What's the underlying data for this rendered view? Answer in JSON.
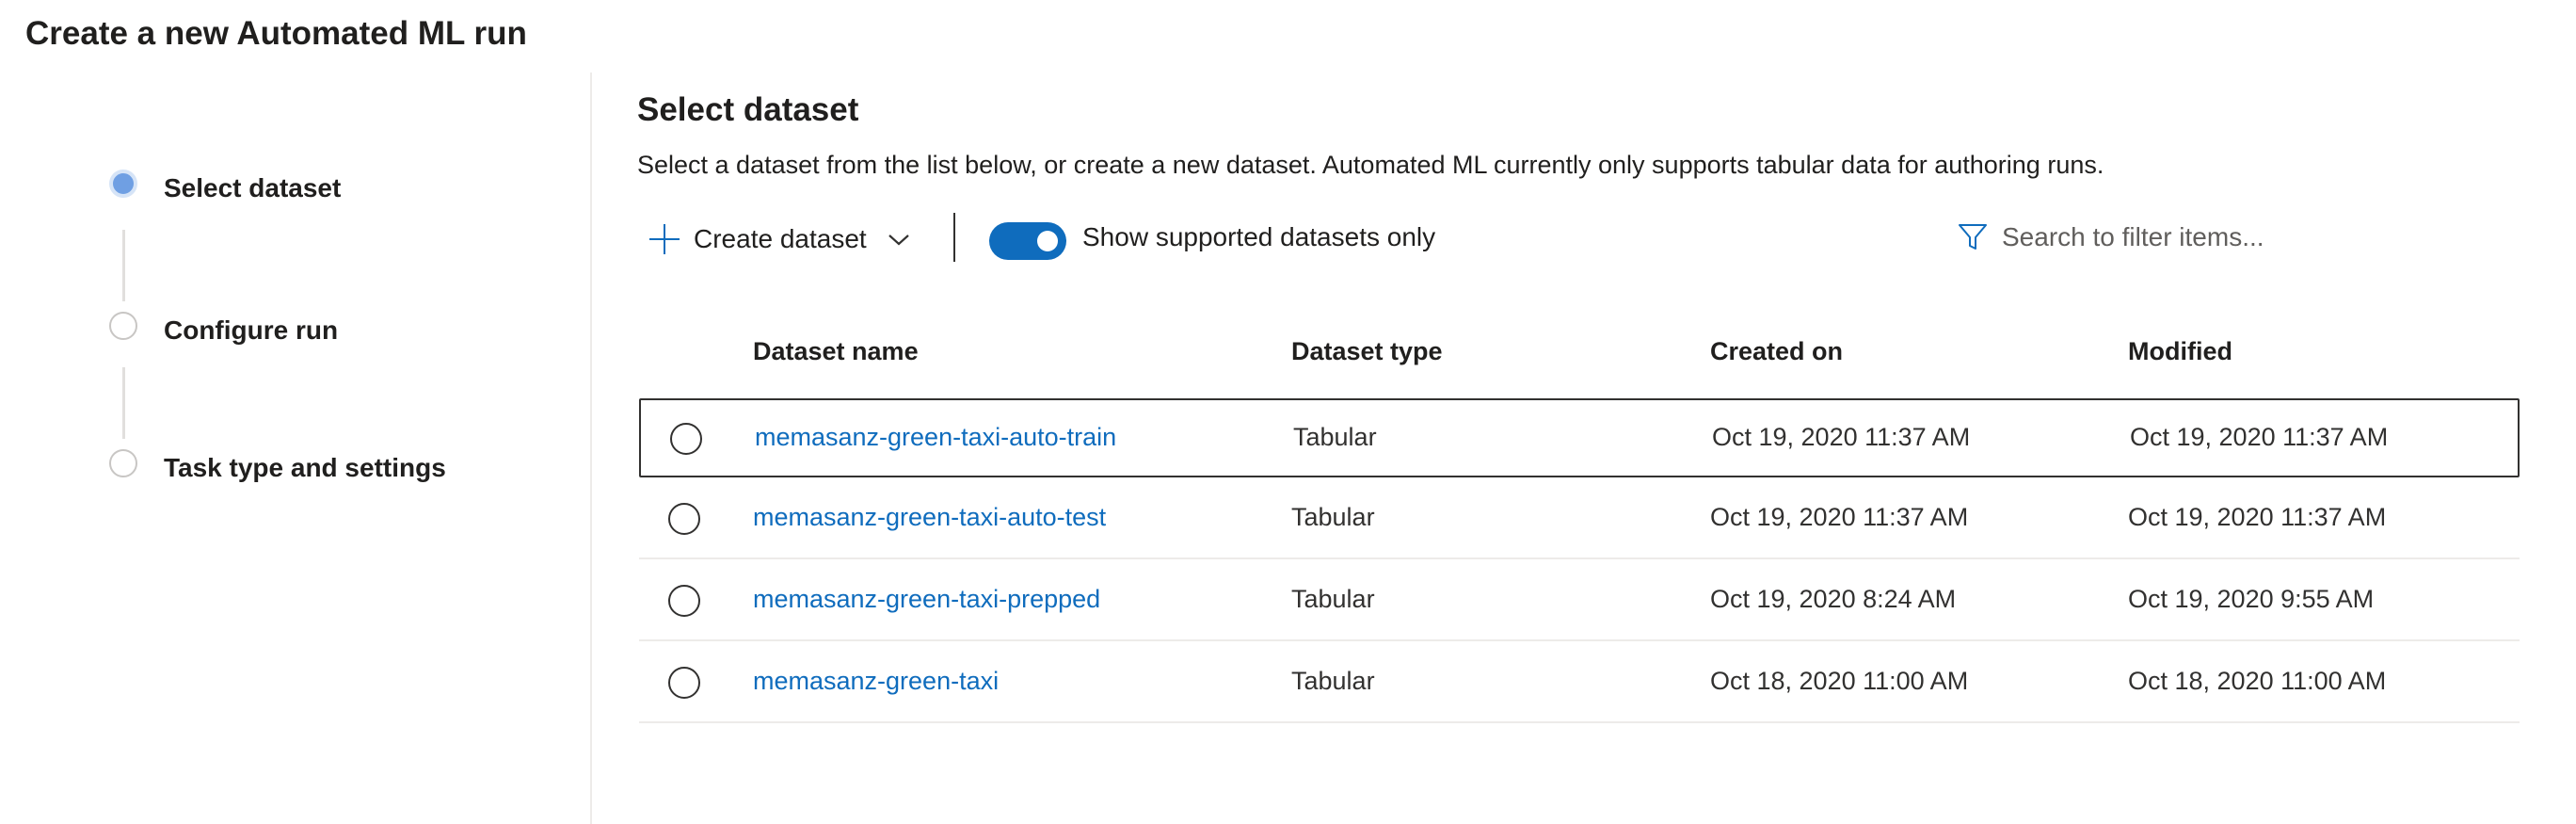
{
  "page": {
    "title": "Create a new Automated ML run"
  },
  "stepper": {
    "steps": [
      {
        "label": "Select dataset",
        "state": "active"
      },
      {
        "label": "Configure run",
        "state": "pending"
      },
      {
        "label": "Task type and settings",
        "state": "pending"
      }
    ]
  },
  "section": {
    "title": "Select dataset",
    "description": "Select a dataset from the list below, or create a new dataset. Automated ML currently only supports tabular data for authoring runs."
  },
  "toolbar": {
    "create_label": "Create dataset",
    "create_icon": "plus-icon",
    "dropdown_icon": "chevron-down-icon",
    "toggle_label": "Show supported datasets only",
    "toggle_on": true,
    "filter_placeholder": "Search to filter items...",
    "filter_icon": "filter-icon"
  },
  "table": {
    "columns": [
      "Dataset name",
      "Dataset type",
      "Created on",
      "Modified"
    ],
    "rows": [
      {
        "name": "memasanz-green-taxi-auto-train",
        "type": "Tabular",
        "created": "Oct 19, 2020 11:37 AM",
        "modified": "Oct 19, 2020 11:37 AM"
      },
      {
        "name": "memasanz-green-taxi-auto-test",
        "type": "Tabular",
        "created": "Oct 19, 2020 11:37 AM",
        "modified": "Oct 19, 2020 11:37 AM"
      },
      {
        "name": "memasanz-green-taxi-prepped",
        "type": "Tabular",
        "created": "Oct 19, 2020 8:24 AM",
        "modified": "Oct 19, 2020 9:55 AM"
      },
      {
        "name": "memasanz-green-taxi",
        "type": "Tabular",
        "created": "Oct 18, 2020 11:00 AM",
        "modified": "Oct 18, 2020 11:00 AM"
      }
    ]
  },
  "colors": {
    "accent": "#0f6cbd",
    "active_step": "#6f9fe3",
    "text": "#201f1e",
    "divider": "#edebe9"
  }
}
